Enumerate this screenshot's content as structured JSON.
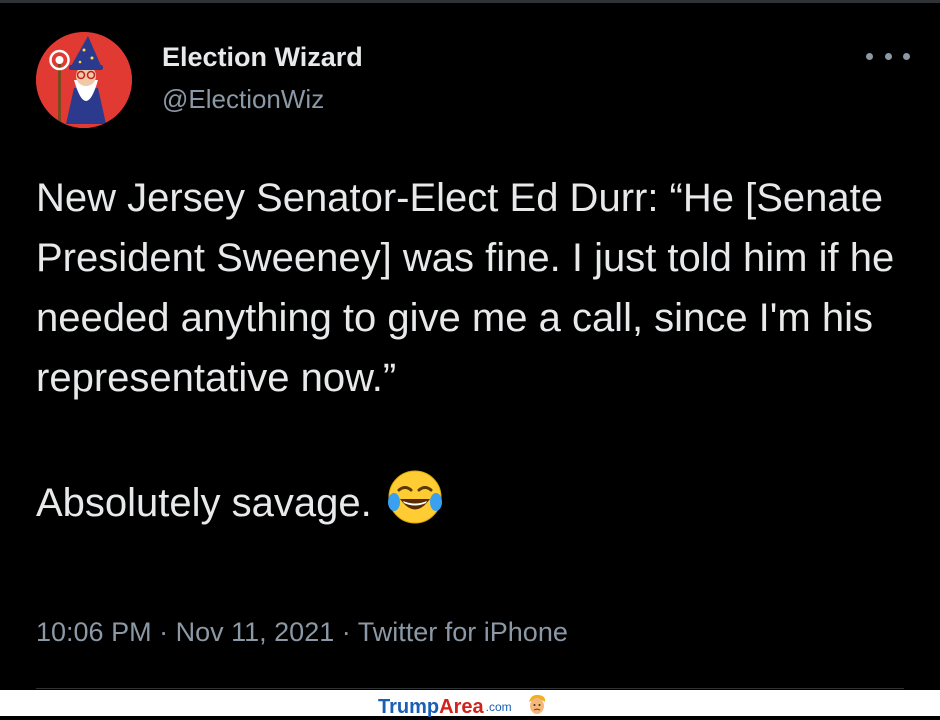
{
  "tweet": {
    "display_name": "Election Wizard",
    "handle": "@ElectionWiz",
    "paragraphs": [
      "New Jersey Senator-Elect Ed Durr: “He [Senate President Sweeney] was fine. I just told him if he needed anything to give me a call, since I'm his representative now.”",
      "Absolutely savage."
    ],
    "emoji": "face-with-tears-of-joy",
    "time": "10:06 PM",
    "date": "Nov 11, 2021",
    "separator": "·",
    "source": "Twitter for iPhone"
  },
  "icons": {
    "avatar": "wizard-avatar-icon",
    "more": "more-options-icon",
    "watermark_face": "trump-face-icon"
  },
  "watermark": {
    "part1": "Trump",
    "part2": "Area",
    "part3": ".com"
  },
  "colors": {
    "background": "#000000",
    "primary_text": "#e7e9ea",
    "secondary_text": "#8b98a5",
    "avatar_bg": "#e03a32",
    "watermark_blue": "#1a5fb4",
    "watermark_red": "#d0231b"
  }
}
